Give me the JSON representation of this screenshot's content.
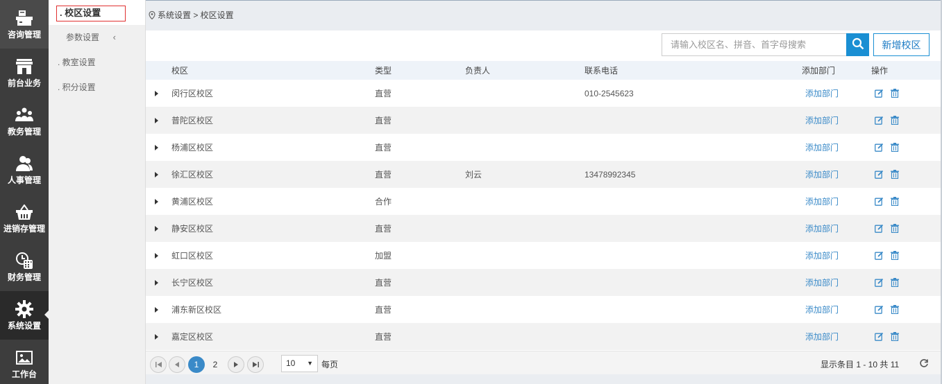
{
  "leftnav": [
    {
      "label": "咨询管理",
      "icon": "counter-icon"
    },
    {
      "label": "前台业务",
      "icon": "storefront-icon"
    },
    {
      "label": "教务管理",
      "icon": "group-icon"
    },
    {
      "label": "人事管理",
      "icon": "users-icon"
    },
    {
      "label": "进销存管理",
      "icon": "basket-icon"
    },
    {
      "label": "财务管理",
      "icon": "calculator-icon"
    },
    {
      "label": "系统设置",
      "icon": "gear-icon",
      "active": true
    },
    {
      "label": "工作台",
      "icon": "picture-icon"
    }
  ],
  "subnav": {
    "active": ". 校区设置",
    "params": "参数设置",
    "params_chevron": "‹",
    "classroom": ". 教室设置",
    "points": ". 积分设置"
  },
  "breadcrumb": "系统设置 > 校区设置",
  "toolbar": {
    "search_placeholder": "请输入校区名、拼音、首字母搜索",
    "add_label": "新增校区"
  },
  "table": {
    "headers": [
      "校区",
      "类型",
      "负责人",
      "联系电话",
      "添加部门",
      "操作"
    ],
    "rows": [
      {
        "name": "闵行区校区",
        "type": "直营",
        "owner": "",
        "phone": "010-2545623",
        "dept": "添加部门"
      },
      {
        "name": "普陀区校区",
        "type": "直营",
        "owner": "",
        "phone": "",
        "dept": "添加部门"
      },
      {
        "name": "杨浦区校区",
        "type": "直营",
        "owner": "",
        "phone": "",
        "dept": "添加部门"
      },
      {
        "name": "徐汇区校区",
        "type": "直营",
        "owner": "刘云",
        "phone": "13478992345",
        "dept": "添加部门"
      },
      {
        "name": "黄浦区校区",
        "type": "合作",
        "owner": "",
        "phone": "",
        "dept": "添加部门"
      },
      {
        "name": "静安区校区",
        "type": "直营",
        "owner": "",
        "phone": "",
        "dept": "添加部门"
      },
      {
        "name": "虹口区校区",
        "type": "加盟",
        "owner": "",
        "phone": "",
        "dept": "添加部门"
      },
      {
        "name": "长宁区校区",
        "type": "直营",
        "owner": "",
        "phone": "",
        "dept": "添加部门"
      },
      {
        "name": "浦东新区校区",
        "type": "直营",
        "owner": "",
        "phone": "",
        "dept": "添加部门"
      },
      {
        "name": "嘉定区校区",
        "type": "直营",
        "owner": "",
        "phone": "",
        "dept": "添加部门"
      }
    ]
  },
  "pager": {
    "pages": [
      "1",
      "2"
    ],
    "current": "1",
    "per_page": "10",
    "per_page_arrow": "▼",
    "per_page_label": "每页",
    "summary": "显示条目 1 - 10 共 11"
  },
  "colors": {
    "accent": "#1a8fd3",
    "link": "#3a8ac8",
    "nav_bg": "#3d3d3d"
  }
}
